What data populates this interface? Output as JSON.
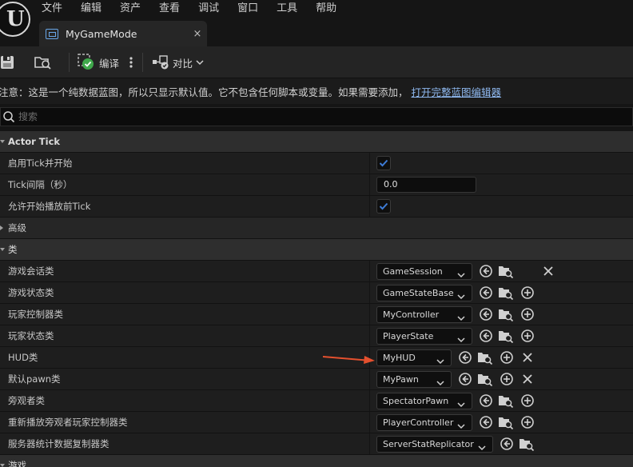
{
  "menu": [
    "文件",
    "编辑",
    "资产",
    "查看",
    "调试",
    "窗口",
    "工具",
    "帮助"
  ],
  "tab": {
    "title": "MyGameMode",
    "close": "×"
  },
  "toolbar": {
    "compile_label": "编译",
    "diff_label": "对比"
  },
  "notice": {
    "text": "注意：这是一个纯数据蓝图，所以只显示默认值。它不包含任何脚本或变量。如果需要添加，",
    "link": "打开完整蓝图编辑器"
  },
  "search": {
    "placeholder": "搜索"
  },
  "sections": {
    "actor_tick": "Actor Tick",
    "advanced": "高级",
    "classes": "类",
    "game": "游戏"
  },
  "actor_tick": {
    "start_with_tick": {
      "label": "启用Tick并开始",
      "checked": true
    },
    "tick_interval": {
      "label": "Tick间隔（秒）",
      "value": "0.0"
    },
    "tick_before_begin": {
      "label": "允许开始播放前Tick",
      "checked": true
    }
  },
  "classes": [
    {
      "label": "游戏会话类",
      "value": "GameSession",
      "width": 120,
      "actions": [
        "use",
        "browse",
        "clear"
      ]
    },
    {
      "label": "游戏状态类",
      "value": "GameStateBase",
      "width": 120,
      "actions": [
        "use",
        "browse",
        "add"
      ]
    },
    {
      "label": "玩家控制器类",
      "value": "MyController",
      "width": 120,
      "actions": [
        "use",
        "browse",
        "add"
      ]
    },
    {
      "label": "玩家状态类",
      "value": "PlayerState",
      "width": 120,
      "actions": [
        "use",
        "browse",
        "add"
      ]
    },
    {
      "label": "HUD类",
      "value": "MyHUD",
      "width": 94,
      "actions": [
        "use",
        "browse",
        "add",
        "clear"
      ]
    },
    {
      "label": "默认pawn类",
      "value": "MyPawn",
      "width": 94,
      "actions": [
        "use",
        "browse",
        "add",
        "clear"
      ]
    },
    {
      "label": "旁观者类",
      "value": "SpectatorPawn",
      "width": 120,
      "actions": [
        "use",
        "browse",
        "add"
      ]
    },
    {
      "label": "重新播放旁观者玩家控制器类",
      "value": "PlayerController",
      "width": 120,
      "actions": [
        "use",
        "browse",
        "add"
      ]
    },
    {
      "label": "服务器统计数据复制器类",
      "value": "ServerStatReplicator",
      "width": 146,
      "actions": [
        "use",
        "browse"
      ]
    }
  ],
  "colors": {
    "accent": "#3d7bd6",
    "arrow": "#e4502e",
    "link": "#8fb9f0"
  }
}
